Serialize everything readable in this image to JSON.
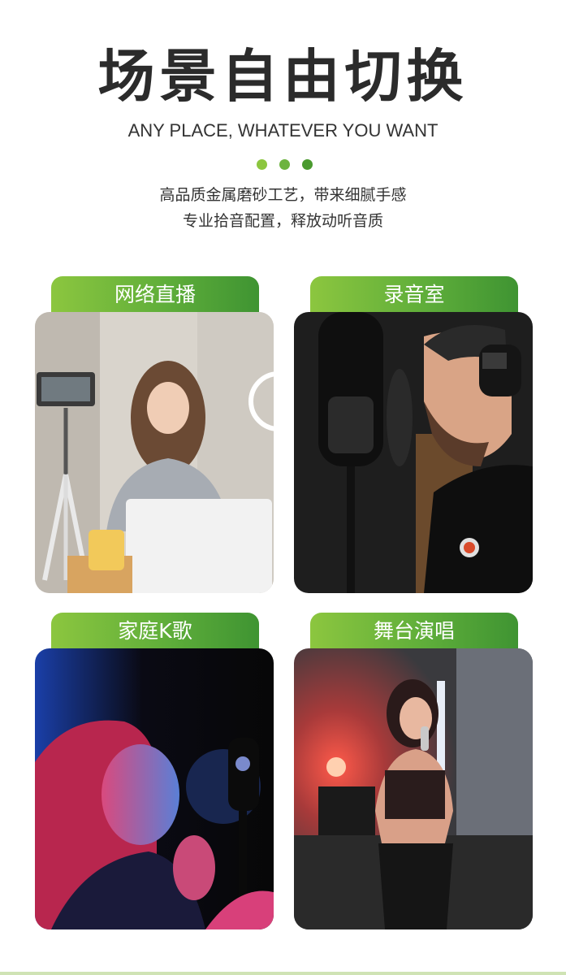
{
  "header": {
    "title": "场景自由切换",
    "subtitle": "ANY PLACE, WHATEVER YOU WANT",
    "description_line1": "高品质金属磨砂工艺，带来细腻手感",
    "description_line2": "专业拾音配置，释放动听音质"
  },
  "accent_colors": {
    "green_light": "#8cc63f",
    "green_mid": "#6db33f",
    "green_dark": "#4a9a2f"
  },
  "scenes": [
    {
      "label": "网络直播",
      "photo": "woman-livestreaming-with-phone-tripod-and-ring-light"
    },
    {
      "label": "录音室",
      "photo": "man-singing-into-studio-microphone-with-headphones"
    },
    {
      "label": "家庭K歌",
      "photo": "woman-singing-into-condenser-microphone-pink-and-blue-light"
    },
    {
      "label": "舞台演唱",
      "photo": "woman-singing-on-stage-with-handheld-microphone"
    }
  ]
}
